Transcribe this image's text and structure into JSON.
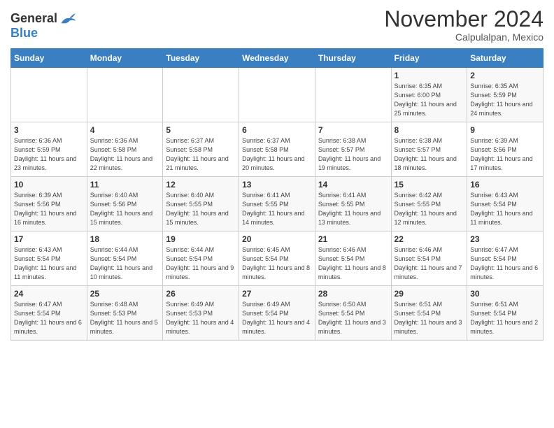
{
  "logo": {
    "general": "General",
    "blue": "Blue"
  },
  "title": "November 2024",
  "location": "Calpulalpan, Mexico",
  "days_of_week": [
    "Sunday",
    "Monday",
    "Tuesday",
    "Wednesday",
    "Thursday",
    "Friday",
    "Saturday"
  ],
  "weeks": [
    [
      {
        "day": "",
        "info": ""
      },
      {
        "day": "",
        "info": ""
      },
      {
        "day": "",
        "info": ""
      },
      {
        "day": "",
        "info": ""
      },
      {
        "day": "",
        "info": ""
      },
      {
        "day": "1",
        "info": "Sunrise: 6:35 AM\nSunset: 6:00 PM\nDaylight: 11 hours and 25 minutes."
      },
      {
        "day": "2",
        "info": "Sunrise: 6:35 AM\nSunset: 5:59 PM\nDaylight: 11 hours and 24 minutes."
      }
    ],
    [
      {
        "day": "3",
        "info": "Sunrise: 6:36 AM\nSunset: 5:59 PM\nDaylight: 11 hours and 23 minutes."
      },
      {
        "day": "4",
        "info": "Sunrise: 6:36 AM\nSunset: 5:58 PM\nDaylight: 11 hours and 22 minutes."
      },
      {
        "day": "5",
        "info": "Sunrise: 6:37 AM\nSunset: 5:58 PM\nDaylight: 11 hours and 21 minutes."
      },
      {
        "day": "6",
        "info": "Sunrise: 6:37 AM\nSunset: 5:58 PM\nDaylight: 11 hours and 20 minutes."
      },
      {
        "day": "7",
        "info": "Sunrise: 6:38 AM\nSunset: 5:57 PM\nDaylight: 11 hours and 19 minutes."
      },
      {
        "day": "8",
        "info": "Sunrise: 6:38 AM\nSunset: 5:57 PM\nDaylight: 11 hours and 18 minutes."
      },
      {
        "day": "9",
        "info": "Sunrise: 6:39 AM\nSunset: 5:56 PM\nDaylight: 11 hours and 17 minutes."
      }
    ],
    [
      {
        "day": "10",
        "info": "Sunrise: 6:39 AM\nSunset: 5:56 PM\nDaylight: 11 hours and 16 minutes."
      },
      {
        "day": "11",
        "info": "Sunrise: 6:40 AM\nSunset: 5:56 PM\nDaylight: 11 hours and 15 minutes."
      },
      {
        "day": "12",
        "info": "Sunrise: 6:40 AM\nSunset: 5:55 PM\nDaylight: 11 hours and 15 minutes."
      },
      {
        "day": "13",
        "info": "Sunrise: 6:41 AM\nSunset: 5:55 PM\nDaylight: 11 hours and 14 minutes."
      },
      {
        "day": "14",
        "info": "Sunrise: 6:41 AM\nSunset: 5:55 PM\nDaylight: 11 hours and 13 minutes."
      },
      {
        "day": "15",
        "info": "Sunrise: 6:42 AM\nSunset: 5:55 PM\nDaylight: 11 hours and 12 minutes."
      },
      {
        "day": "16",
        "info": "Sunrise: 6:43 AM\nSunset: 5:54 PM\nDaylight: 11 hours and 11 minutes."
      }
    ],
    [
      {
        "day": "17",
        "info": "Sunrise: 6:43 AM\nSunset: 5:54 PM\nDaylight: 11 hours and 11 minutes."
      },
      {
        "day": "18",
        "info": "Sunrise: 6:44 AM\nSunset: 5:54 PM\nDaylight: 11 hours and 10 minutes."
      },
      {
        "day": "19",
        "info": "Sunrise: 6:44 AM\nSunset: 5:54 PM\nDaylight: 11 hours and 9 minutes."
      },
      {
        "day": "20",
        "info": "Sunrise: 6:45 AM\nSunset: 5:54 PM\nDaylight: 11 hours and 8 minutes."
      },
      {
        "day": "21",
        "info": "Sunrise: 6:46 AM\nSunset: 5:54 PM\nDaylight: 11 hours and 8 minutes."
      },
      {
        "day": "22",
        "info": "Sunrise: 6:46 AM\nSunset: 5:54 PM\nDaylight: 11 hours and 7 minutes."
      },
      {
        "day": "23",
        "info": "Sunrise: 6:47 AM\nSunset: 5:54 PM\nDaylight: 11 hours and 6 minutes."
      }
    ],
    [
      {
        "day": "24",
        "info": "Sunrise: 6:47 AM\nSunset: 5:54 PM\nDaylight: 11 hours and 6 minutes."
      },
      {
        "day": "25",
        "info": "Sunrise: 6:48 AM\nSunset: 5:53 PM\nDaylight: 11 hours and 5 minutes."
      },
      {
        "day": "26",
        "info": "Sunrise: 6:49 AM\nSunset: 5:53 PM\nDaylight: 11 hours and 4 minutes."
      },
      {
        "day": "27",
        "info": "Sunrise: 6:49 AM\nSunset: 5:54 PM\nDaylight: 11 hours and 4 minutes."
      },
      {
        "day": "28",
        "info": "Sunrise: 6:50 AM\nSunset: 5:54 PM\nDaylight: 11 hours and 3 minutes."
      },
      {
        "day": "29",
        "info": "Sunrise: 6:51 AM\nSunset: 5:54 PM\nDaylight: 11 hours and 3 minutes."
      },
      {
        "day": "30",
        "info": "Sunrise: 6:51 AM\nSunset: 5:54 PM\nDaylight: 11 hours and 2 minutes."
      }
    ]
  ]
}
